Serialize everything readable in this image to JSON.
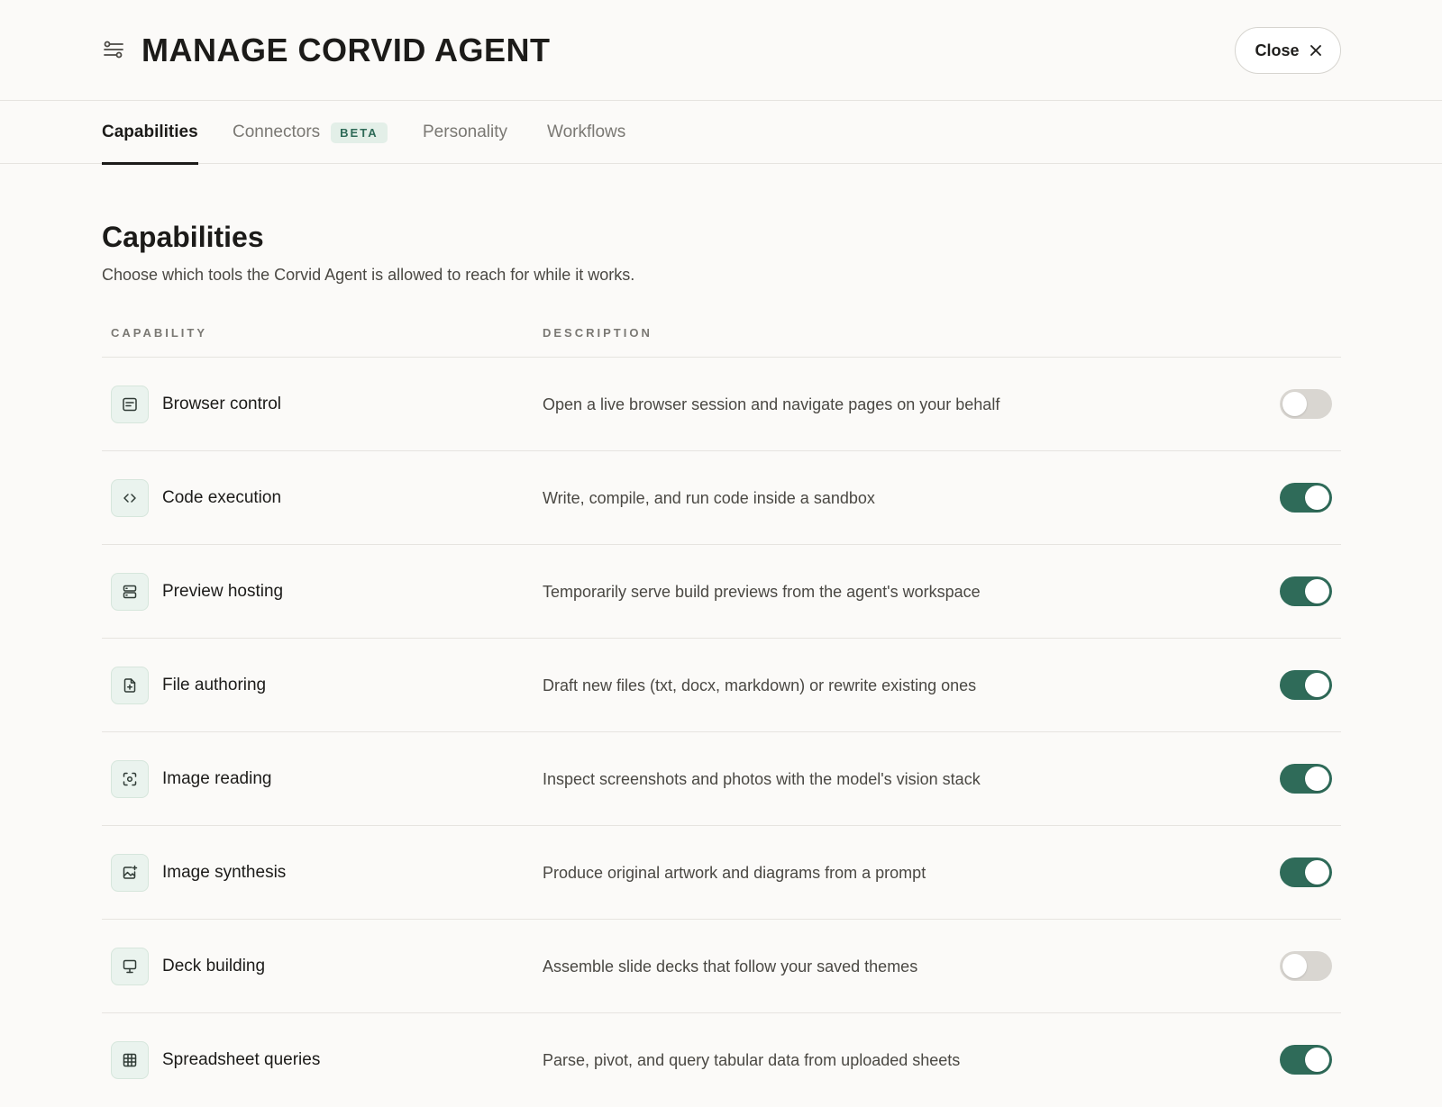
{
  "header": {
    "title": "MANAGE CORVID AGENT",
    "close_label": "Close"
  },
  "tabs": [
    {
      "label": "Capabilities",
      "active": true
    },
    {
      "label": "Connectors",
      "badge": "BETA"
    },
    {
      "label": "Personality"
    },
    {
      "label": "Workflows"
    }
  ],
  "section": {
    "title": "Capabilities",
    "description": "Choose which tools the Corvid Agent is allowed to reach for while it works."
  },
  "table": {
    "col_capability": "CAPABILITY",
    "col_description": "DESCRIPTION",
    "rows": [
      {
        "name": "Browser control",
        "description": "Open a live browser session and navigate pages on your behalf",
        "enabled": false,
        "icon": "browser-icon"
      },
      {
        "name": "Code execution",
        "description": "Write, compile, and run code inside a sandbox",
        "enabled": true,
        "icon": "code-icon"
      },
      {
        "name": "Preview hosting",
        "description": "Temporarily serve build previews from the agent's workspace",
        "enabled": true,
        "icon": "server-icon"
      },
      {
        "name": "File authoring",
        "description": "Draft new files (txt, docx, markdown) or rewrite existing ones",
        "enabled": true,
        "icon": "file-plus-icon"
      },
      {
        "name": "Image reading",
        "description": "Inspect screenshots and photos with the model's vision stack",
        "enabled": true,
        "icon": "scan-icon"
      },
      {
        "name": "Image synthesis",
        "description": "Produce original artwork and diagrams from a prompt",
        "enabled": true,
        "icon": "image-plus-icon"
      },
      {
        "name": "Deck building",
        "description": "Assemble slide decks that follow your saved themes",
        "enabled": false,
        "icon": "presentation-icon"
      },
      {
        "name": "Spreadsheet queries",
        "description": "Parse, pivot, and query tabular data from uploaded sheets",
        "enabled": true,
        "icon": "table-icon"
      }
    ]
  },
  "colors": {
    "accent": "#2f6b59",
    "toggle_off": "#d9d6d1",
    "badge_bg": "#e3efe8",
    "background": "#fbfaf8"
  }
}
